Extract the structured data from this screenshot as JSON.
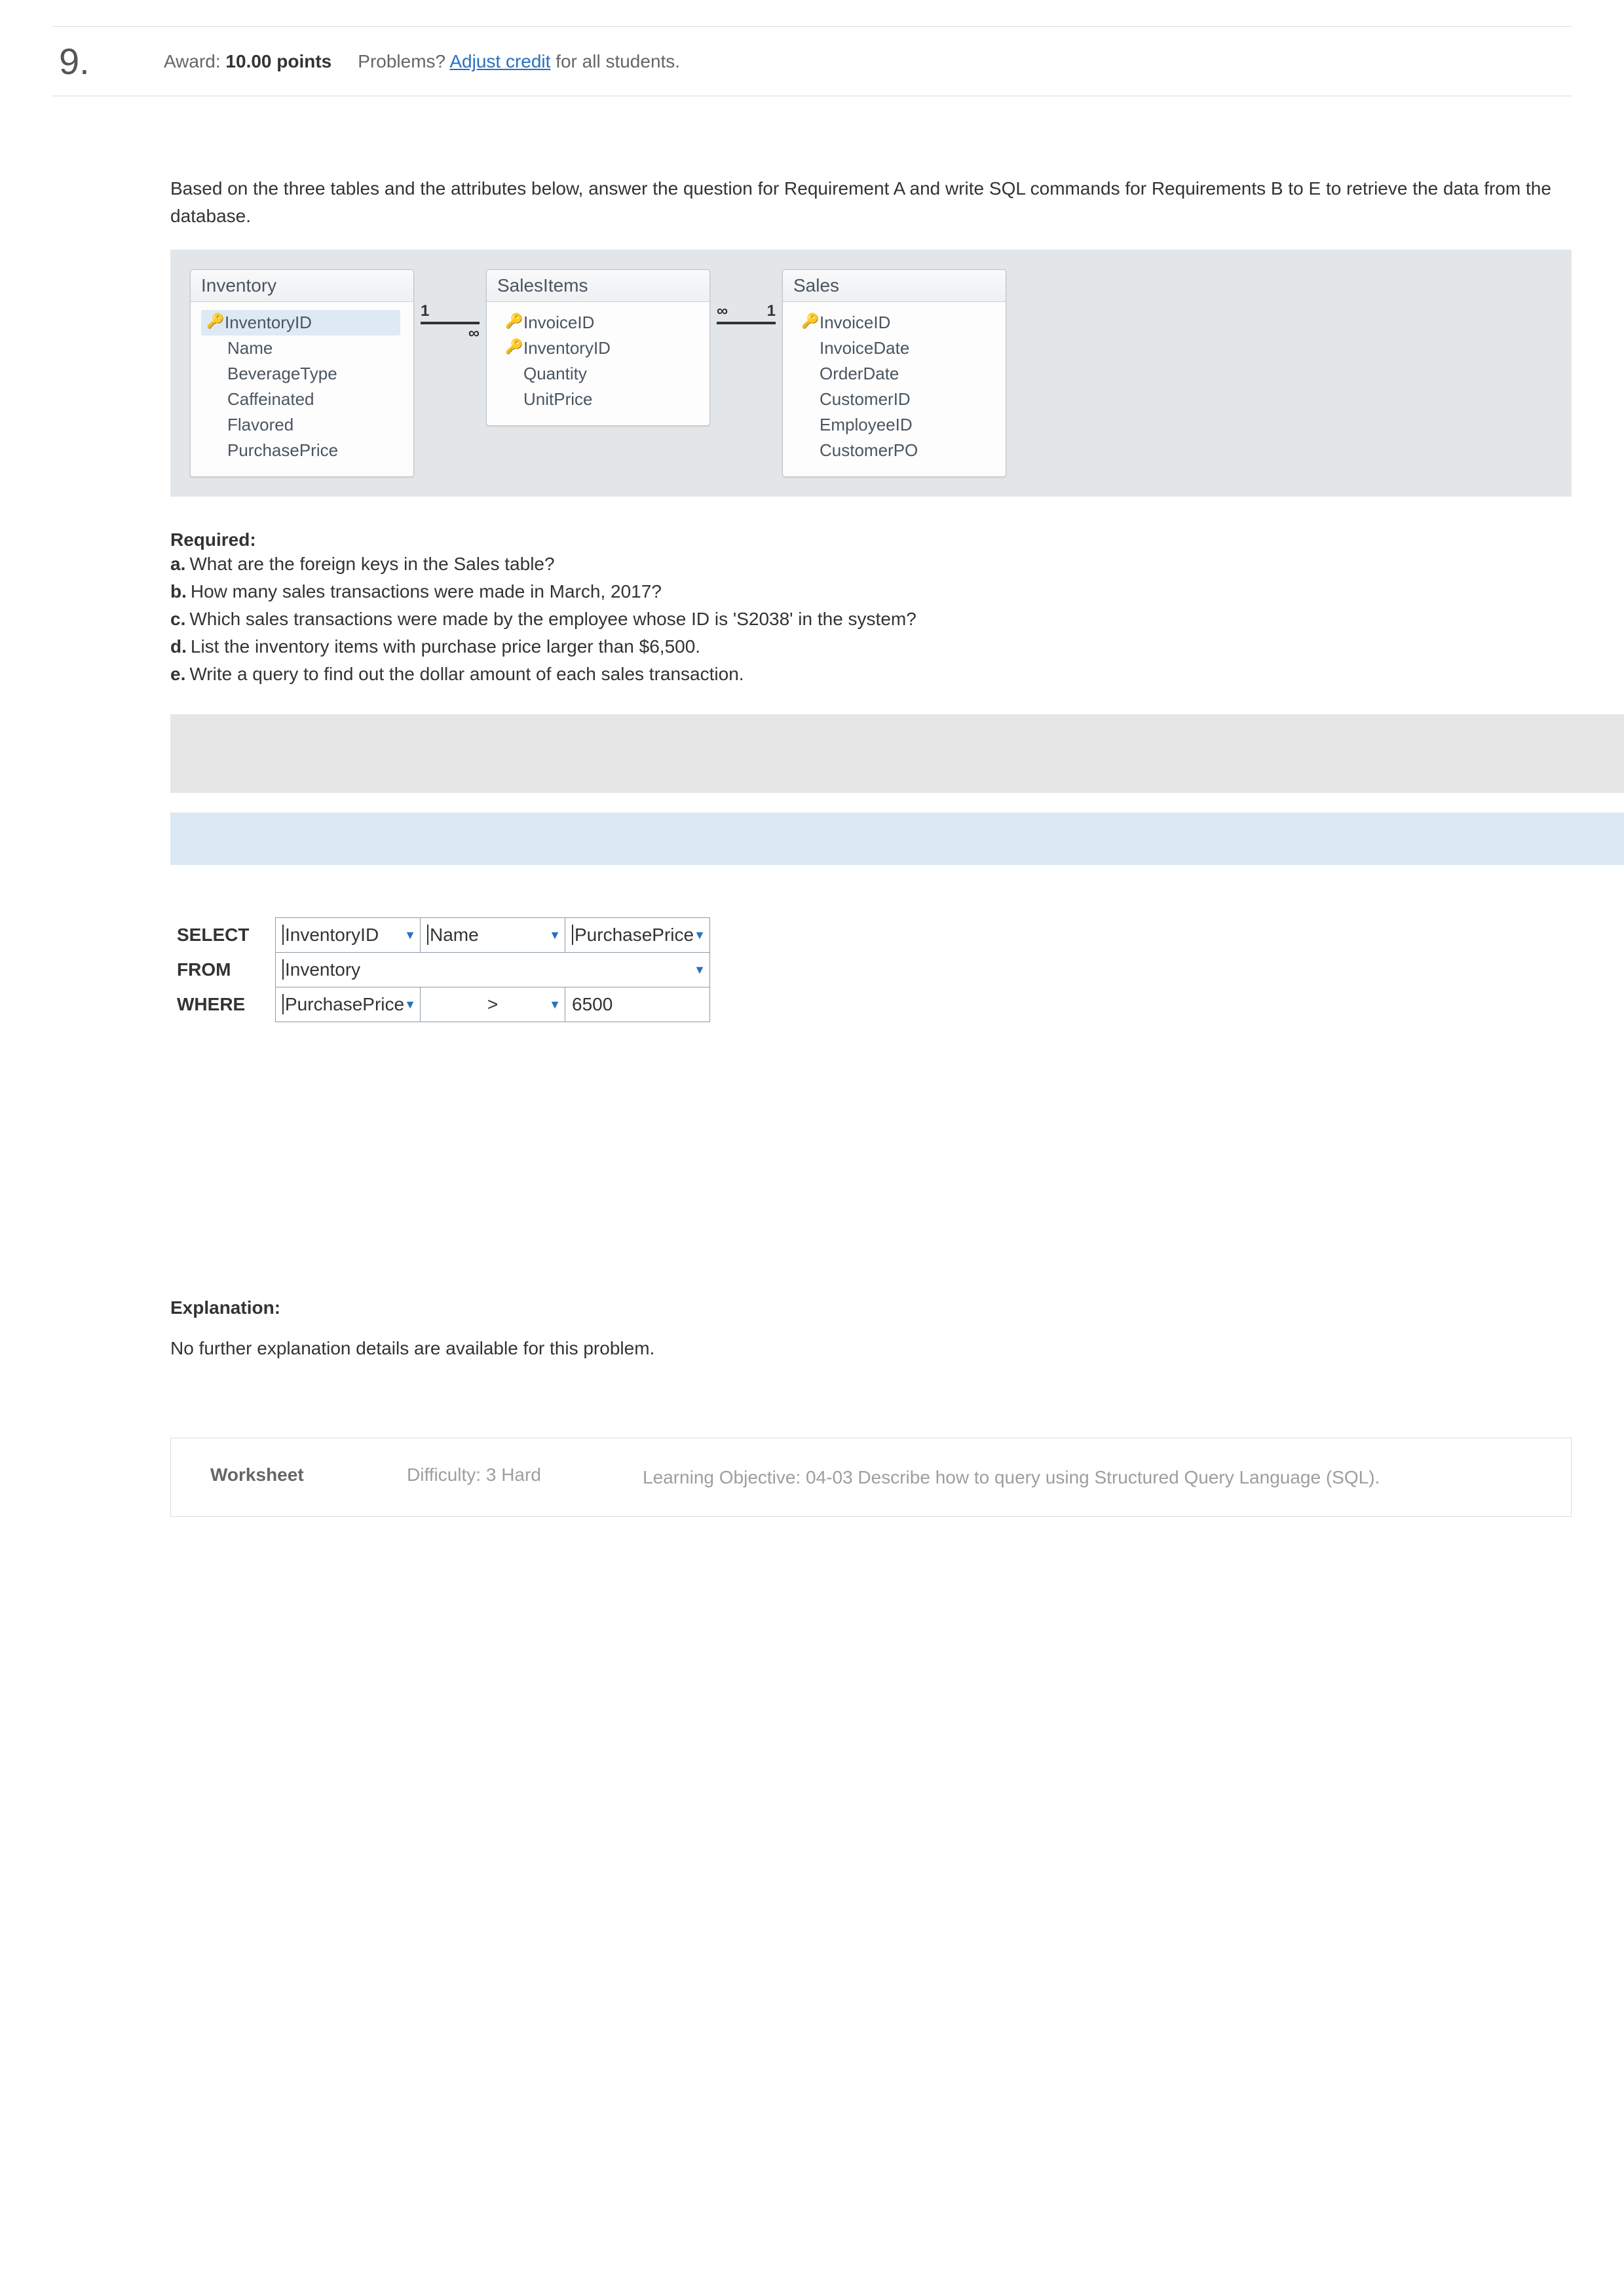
{
  "header": {
    "qnum": "9.",
    "award_label": "Award:",
    "award_value": "10.00 points",
    "problems_label": "Problems?",
    "adjust_link": "Adjust credit",
    "adjust_suffix": "for all students."
  },
  "prompt": "Based on the three tables and the attributes below, answer the question for Requirement A and write SQL commands for Requirements B to E to retrieve the data from the database.",
  "diagram": {
    "entities": [
      {
        "title": "Inventory",
        "attrs": [
          {
            "name": "InventoryID",
            "key": true
          },
          {
            "name": "Name"
          },
          {
            "name": "BeverageType"
          },
          {
            "name": "Caffeinated"
          },
          {
            "name": "Flavored"
          },
          {
            "name": "PurchasePrice"
          }
        ]
      },
      {
        "title": "SalesItems",
        "attrs": [
          {
            "name": "InvoiceID",
            "key": true
          },
          {
            "name": "InventoryID",
            "key": true
          },
          {
            "name": "Quantity"
          },
          {
            "name": "UnitPrice"
          }
        ]
      },
      {
        "title": "Sales",
        "attrs": [
          {
            "name": "InvoiceID",
            "key": true
          },
          {
            "name": "InvoiceDate"
          },
          {
            "name": "OrderDate"
          },
          {
            "name": "CustomerID"
          },
          {
            "name": "EmployeeID"
          },
          {
            "name": "CustomerPO"
          }
        ]
      }
    ],
    "rel1": {
      "left": "1",
      "right": "∞"
    },
    "rel2": {
      "left": "∞",
      "right": "1"
    }
  },
  "required": {
    "title": "Required:",
    "items": [
      {
        "label": "a.",
        "text": "What are the foreign keys in the Sales table?"
      },
      {
        "label": "b.",
        "text": "How many sales transactions were made in March, 2017?"
      },
      {
        "label": "c.",
        "text": "Which sales transactions were made by the employee whose ID is 'S2038' in the system?"
      },
      {
        "label": "d.",
        "text": "List the inventory items with purchase price larger than $6,500."
      },
      {
        "label": "e.",
        "text": "Write a query to find out the dollar amount of each sales transaction."
      }
    ]
  },
  "sql": {
    "select_kw": "SELECT",
    "from_kw": "FROM",
    "where_kw": "WHERE",
    "select": [
      "InventoryID",
      "Name",
      "PurchasePrice"
    ],
    "from": "Inventory",
    "where_field": "PurchasePrice",
    "where_op": ">",
    "where_val": "6500"
  },
  "explanation": {
    "title": "Explanation:",
    "text": "No further explanation details are available for this problem."
  },
  "footer": {
    "worksheet": "Worksheet",
    "difficulty": "Difficulty: 3 Hard",
    "lo": "Learning Objective: 04-03 Describe how to query using Structured Query Language (SQL)."
  }
}
